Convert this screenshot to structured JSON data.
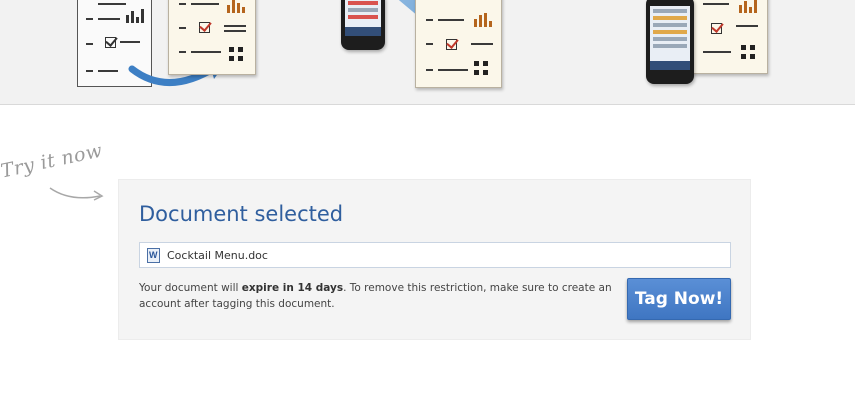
{
  "hero": {
    "icons": [
      "document-icon",
      "arrow-icon",
      "phone-icon",
      "scan-beam-icon",
      "phone-icon"
    ]
  },
  "try_it_now": {
    "label": "Try it now"
  },
  "panel": {
    "title": "Document selected",
    "file": {
      "icon": "word-document-icon",
      "name": "Cocktail Menu.doc"
    },
    "notice": {
      "prefix": "Your document will ",
      "emphasis": "expire in 14 days",
      "suffix": ". To remove this restriction, make sure to create an account after tagging this document."
    },
    "tag_button_label": "Tag Now!"
  },
  "colors": {
    "title": "#2f5e9e",
    "button": "#4a80cc",
    "panel_bg": "#f4f4f4",
    "hero_bg": "#f2f2f2"
  }
}
